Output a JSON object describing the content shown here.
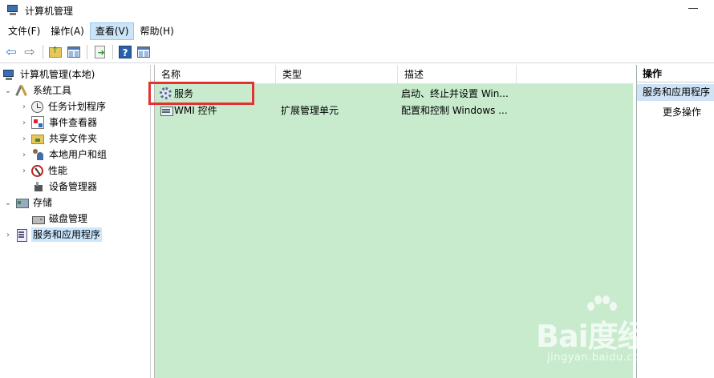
{
  "window": {
    "title": "计算机管理"
  },
  "menu": {
    "items": [
      {
        "label": "文件(F)",
        "active": false
      },
      {
        "label": "操作(A)",
        "active": false
      },
      {
        "label": "查看(V)",
        "active": true
      },
      {
        "label": "帮助(H)",
        "active": false
      }
    ]
  },
  "toolbar": {
    "buttons": [
      "back-icon",
      "forward-icon",
      "up-folder-icon",
      "show-hide-tree-icon",
      "export-list-icon",
      "help-icon",
      "show-hide-action-pane-icon"
    ]
  },
  "tree": {
    "root": "计算机管理(本地)",
    "items": [
      {
        "label": "系统工具",
        "icon": "tools-icon",
        "expander": "expanded"
      },
      {
        "label": "任务计划程序",
        "icon": "clock-icon",
        "expander": "collapsed"
      },
      {
        "label": "事件查看器",
        "icon": "event-viewer-icon",
        "expander": "collapsed"
      },
      {
        "label": "共享文件夹",
        "icon": "shared-folder-icon",
        "expander": "collapsed"
      },
      {
        "label": "本地用户和组",
        "icon": "users-icon",
        "expander": "collapsed"
      },
      {
        "label": "性能",
        "icon": "performance-icon",
        "expander": "collapsed"
      },
      {
        "label": "设备管理器",
        "icon": "device-manager-icon",
        "expander": "none"
      },
      {
        "label": "存储",
        "icon": "storage-icon",
        "expander": "expanded"
      },
      {
        "label": "磁盘管理",
        "icon": "disk-icon",
        "expander": "none"
      },
      {
        "label": "服务和应用程序",
        "icon": "services-apps-icon",
        "expander": "collapsed",
        "selected": true
      }
    ]
  },
  "list": {
    "columns": [
      "名称",
      "类型",
      "描述"
    ],
    "rows": [
      {
        "name": "服务",
        "type": "",
        "description": "启动、终止并设置 Win...",
        "icon": "services-gear-icon",
        "highlighted": true
      },
      {
        "name": "WMI 控件",
        "type": "扩展管理单元",
        "description": "配置和控制 Windows ...",
        "icon": "wmi-icon"
      }
    ]
  },
  "actions": {
    "header": "操作",
    "section": "服务和应用程序",
    "more": "更多操作"
  },
  "watermark": {
    "logo": "Bai度经验",
    "url": "jingyan.baidu.com"
  },
  "colors": {
    "list_background": "#c7ebcc",
    "selection": "#cce8ff",
    "highlight_box": "#e23232",
    "action_section": "#cfe3f6"
  }
}
